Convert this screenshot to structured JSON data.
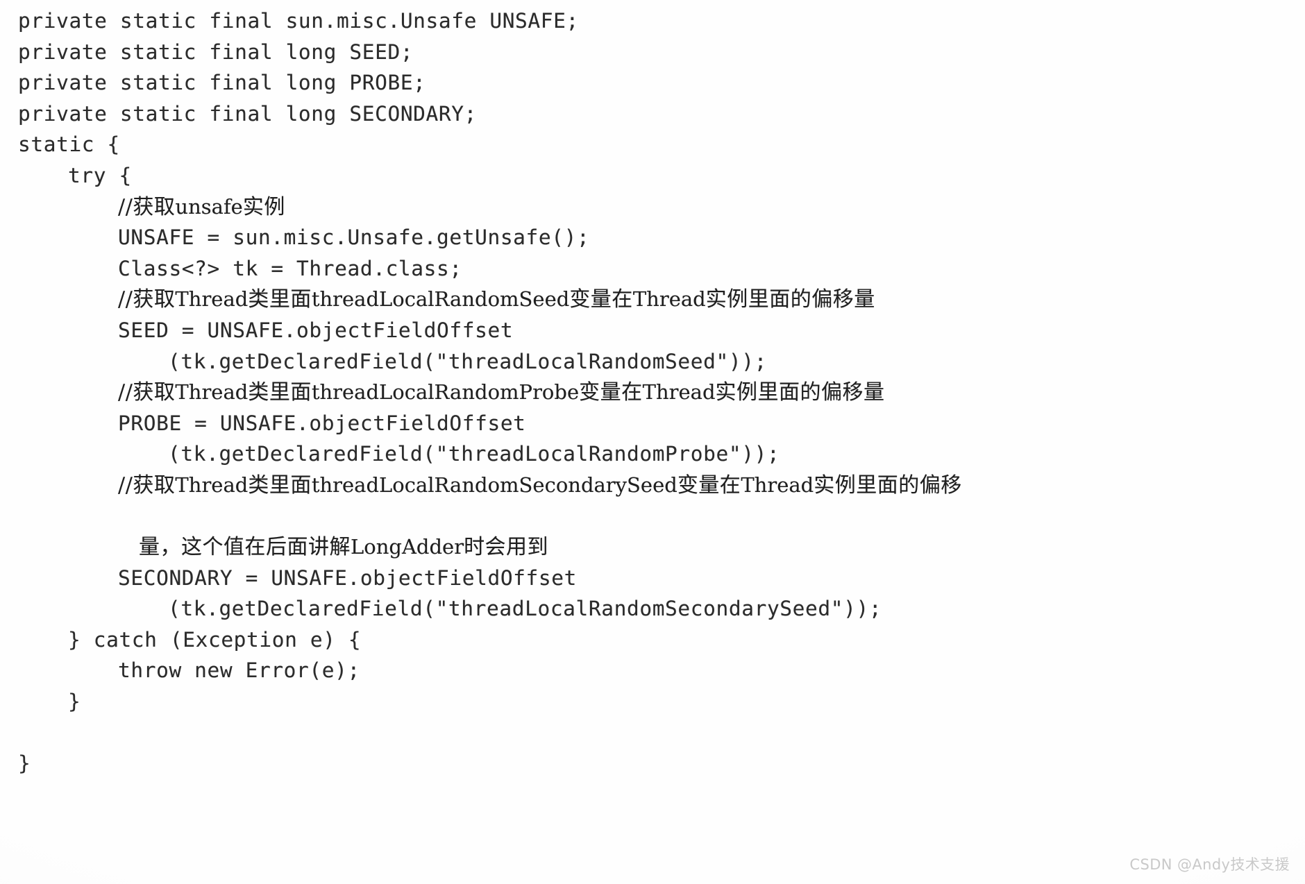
{
  "page": {
    "kind": "scanned-code-listing",
    "background_color": "#fefefe",
    "text_color": "#2b2b2b"
  },
  "code": {
    "language": "java",
    "lines": [
      {
        "indent": 0,
        "segments": [
          {
            "type": "code",
            "text": "private static final sun.misc.Unsafe UNSAFE;"
          }
        ]
      },
      {
        "indent": 0,
        "segments": [
          {
            "type": "code",
            "text": "private static final long SEED;"
          }
        ]
      },
      {
        "indent": 0,
        "segments": [
          {
            "type": "code",
            "text": "private static final long PROBE;"
          }
        ]
      },
      {
        "indent": 0,
        "segments": [
          {
            "type": "code",
            "text": "private static final long SECONDARY;"
          }
        ]
      },
      {
        "indent": 0,
        "segments": [
          {
            "type": "code",
            "text": "static {"
          }
        ]
      },
      {
        "indent": 1,
        "segments": [
          {
            "type": "code",
            "text": "try {"
          }
        ]
      },
      {
        "indent": 2,
        "segments": [
          {
            "type": "slash",
            "text": "//"
          },
          {
            "type": "cn",
            "text": "获取"
          },
          {
            "type": "cn-latin",
            "text": "unsafe"
          },
          {
            "type": "cn",
            "text": "实例"
          }
        ]
      },
      {
        "indent": 2,
        "segments": [
          {
            "type": "code",
            "text": "UNSAFE = sun.misc.Unsafe.getUnsafe();"
          }
        ]
      },
      {
        "indent": 2,
        "segments": [
          {
            "type": "code",
            "text": "Class<?> tk = Thread.class;"
          }
        ]
      },
      {
        "indent": 2,
        "segments": [
          {
            "type": "slash",
            "text": "//"
          },
          {
            "type": "cn",
            "text": "获取"
          },
          {
            "type": "cn-latin",
            "text": "Thread"
          },
          {
            "type": "cn",
            "text": "类里面"
          },
          {
            "type": "cn-latin",
            "text": "threadLocalRandomSeed"
          },
          {
            "type": "cn",
            "text": "变量在"
          },
          {
            "type": "cn-latin",
            "text": "Thread"
          },
          {
            "type": "cn",
            "text": "实例里面的偏移量"
          }
        ]
      },
      {
        "indent": 2,
        "segments": [
          {
            "type": "code",
            "text": "SEED = UNSAFE.objectFieldOffset"
          }
        ]
      },
      {
        "indent": 3,
        "segments": [
          {
            "type": "code",
            "text": "(tk.getDeclaredField(\"threadLocalRandomSeed\"));"
          }
        ]
      },
      {
        "indent": 2,
        "segments": [
          {
            "type": "slash",
            "text": "//"
          },
          {
            "type": "cn",
            "text": "获取"
          },
          {
            "type": "cn-latin",
            "text": "Thread"
          },
          {
            "type": "cn",
            "text": "类里面"
          },
          {
            "type": "cn-latin",
            "text": "threadLocalRandomProbe"
          },
          {
            "type": "cn",
            "text": "变量在"
          },
          {
            "type": "cn-latin",
            "text": "Thread"
          },
          {
            "type": "cn",
            "text": "实例里面的偏移量"
          }
        ]
      },
      {
        "indent": 2,
        "segments": [
          {
            "type": "code",
            "text": "PROBE = UNSAFE.objectFieldOffset"
          }
        ]
      },
      {
        "indent": 3,
        "segments": [
          {
            "type": "code",
            "text": "(tk.getDeclaredField(\"threadLocalRandomProbe\"));"
          }
        ]
      },
      {
        "indent": 2,
        "segments": [
          {
            "type": "slash",
            "text": "//"
          },
          {
            "type": "cn",
            "text": "获取"
          },
          {
            "type": "cn-latin",
            "text": "Thread"
          },
          {
            "type": "cn",
            "text": "类里面"
          },
          {
            "type": "cn-latin",
            "text": "threadLocalRandomSecondarySeed"
          },
          {
            "type": "cn",
            "text": "变量在"
          },
          {
            "type": "cn-latin",
            "text": "Thread"
          },
          {
            "type": "cn",
            "text": "实例里面的偏移"
          }
        ]
      },
      {
        "indent": 0,
        "segments": []
      },
      {
        "indent": 2,
        "extra": 30,
        "segments": [
          {
            "type": "cn",
            "text": "量，这个值在后面讲解"
          },
          {
            "type": "cn-latin",
            "text": "LongAdder"
          },
          {
            "type": "cn",
            "text": "时会用到"
          }
        ]
      },
      {
        "indent": 2,
        "segments": [
          {
            "type": "code",
            "text": "SECONDARY = UNSAFE.objectFieldOffset"
          }
        ]
      },
      {
        "indent": 3,
        "segments": [
          {
            "type": "code",
            "text": "(tk.getDeclaredField(\"threadLocalRandomSecondarySeed\"));"
          }
        ]
      },
      {
        "indent": 1,
        "segments": [
          {
            "type": "code",
            "text": "} catch (Exception e) {"
          }
        ]
      },
      {
        "indent": 2,
        "segments": [
          {
            "type": "code",
            "text": "throw new Error(e);"
          }
        ]
      },
      {
        "indent": 1,
        "segments": [
          {
            "type": "code",
            "text": "}"
          }
        ]
      },
      {
        "indent": 0,
        "segments": []
      },
      {
        "indent": 0,
        "segments": [
          {
            "type": "code",
            "text": "}"
          }
        ]
      }
    ]
  },
  "watermark": {
    "text": "CSDN @Andy技术支援"
  }
}
